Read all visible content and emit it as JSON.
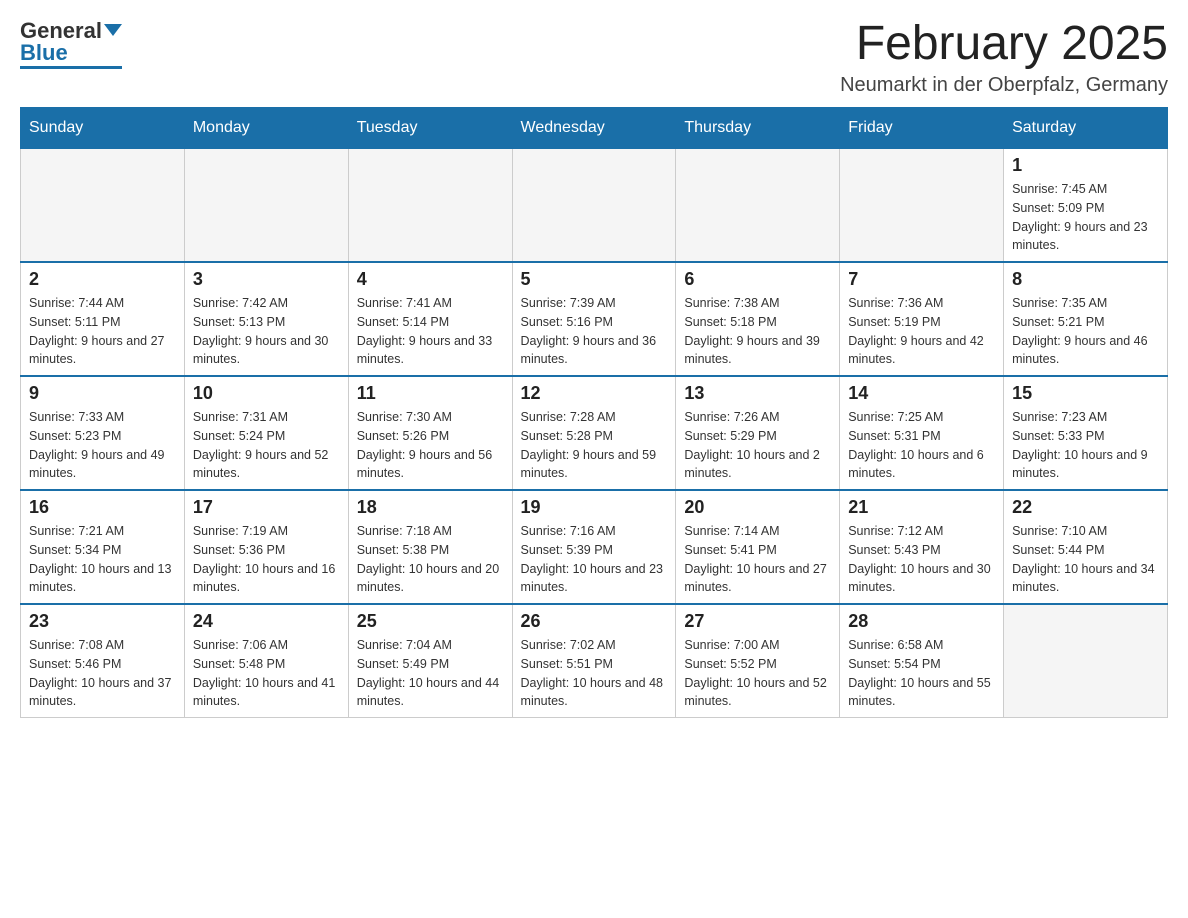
{
  "header": {
    "logo_general": "General",
    "logo_blue": "Blue",
    "month_title": "February 2025",
    "location": "Neumarkt in der Oberpfalz, Germany"
  },
  "days_of_week": [
    "Sunday",
    "Monday",
    "Tuesday",
    "Wednesday",
    "Thursday",
    "Friday",
    "Saturday"
  ],
  "weeks": [
    [
      {
        "day": "",
        "info": ""
      },
      {
        "day": "",
        "info": ""
      },
      {
        "day": "",
        "info": ""
      },
      {
        "day": "",
        "info": ""
      },
      {
        "day": "",
        "info": ""
      },
      {
        "day": "",
        "info": ""
      },
      {
        "day": "1",
        "info": "Sunrise: 7:45 AM\nSunset: 5:09 PM\nDaylight: 9 hours and 23 minutes."
      }
    ],
    [
      {
        "day": "2",
        "info": "Sunrise: 7:44 AM\nSunset: 5:11 PM\nDaylight: 9 hours and 27 minutes."
      },
      {
        "day": "3",
        "info": "Sunrise: 7:42 AM\nSunset: 5:13 PM\nDaylight: 9 hours and 30 minutes."
      },
      {
        "day": "4",
        "info": "Sunrise: 7:41 AM\nSunset: 5:14 PM\nDaylight: 9 hours and 33 minutes."
      },
      {
        "day": "5",
        "info": "Sunrise: 7:39 AM\nSunset: 5:16 PM\nDaylight: 9 hours and 36 minutes."
      },
      {
        "day": "6",
        "info": "Sunrise: 7:38 AM\nSunset: 5:18 PM\nDaylight: 9 hours and 39 minutes."
      },
      {
        "day": "7",
        "info": "Sunrise: 7:36 AM\nSunset: 5:19 PM\nDaylight: 9 hours and 42 minutes."
      },
      {
        "day": "8",
        "info": "Sunrise: 7:35 AM\nSunset: 5:21 PM\nDaylight: 9 hours and 46 minutes."
      }
    ],
    [
      {
        "day": "9",
        "info": "Sunrise: 7:33 AM\nSunset: 5:23 PM\nDaylight: 9 hours and 49 minutes."
      },
      {
        "day": "10",
        "info": "Sunrise: 7:31 AM\nSunset: 5:24 PM\nDaylight: 9 hours and 52 minutes."
      },
      {
        "day": "11",
        "info": "Sunrise: 7:30 AM\nSunset: 5:26 PM\nDaylight: 9 hours and 56 minutes."
      },
      {
        "day": "12",
        "info": "Sunrise: 7:28 AM\nSunset: 5:28 PM\nDaylight: 9 hours and 59 minutes."
      },
      {
        "day": "13",
        "info": "Sunrise: 7:26 AM\nSunset: 5:29 PM\nDaylight: 10 hours and 2 minutes."
      },
      {
        "day": "14",
        "info": "Sunrise: 7:25 AM\nSunset: 5:31 PM\nDaylight: 10 hours and 6 minutes."
      },
      {
        "day": "15",
        "info": "Sunrise: 7:23 AM\nSunset: 5:33 PM\nDaylight: 10 hours and 9 minutes."
      }
    ],
    [
      {
        "day": "16",
        "info": "Sunrise: 7:21 AM\nSunset: 5:34 PM\nDaylight: 10 hours and 13 minutes."
      },
      {
        "day": "17",
        "info": "Sunrise: 7:19 AM\nSunset: 5:36 PM\nDaylight: 10 hours and 16 minutes."
      },
      {
        "day": "18",
        "info": "Sunrise: 7:18 AM\nSunset: 5:38 PM\nDaylight: 10 hours and 20 minutes."
      },
      {
        "day": "19",
        "info": "Sunrise: 7:16 AM\nSunset: 5:39 PM\nDaylight: 10 hours and 23 minutes."
      },
      {
        "day": "20",
        "info": "Sunrise: 7:14 AM\nSunset: 5:41 PM\nDaylight: 10 hours and 27 minutes."
      },
      {
        "day": "21",
        "info": "Sunrise: 7:12 AM\nSunset: 5:43 PM\nDaylight: 10 hours and 30 minutes."
      },
      {
        "day": "22",
        "info": "Sunrise: 7:10 AM\nSunset: 5:44 PM\nDaylight: 10 hours and 34 minutes."
      }
    ],
    [
      {
        "day": "23",
        "info": "Sunrise: 7:08 AM\nSunset: 5:46 PM\nDaylight: 10 hours and 37 minutes."
      },
      {
        "day": "24",
        "info": "Sunrise: 7:06 AM\nSunset: 5:48 PM\nDaylight: 10 hours and 41 minutes."
      },
      {
        "day": "25",
        "info": "Sunrise: 7:04 AM\nSunset: 5:49 PM\nDaylight: 10 hours and 44 minutes."
      },
      {
        "day": "26",
        "info": "Sunrise: 7:02 AM\nSunset: 5:51 PM\nDaylight: 10 hours and 48 minutes."
      },
      {
        "day": "27",
        "info": "Sunrise: 7:00 AM\nSunset: 5:52 PM\nDaylight: 10 hours and 52 minutes."
      },
      {
        "day": "28",
        "info": "Sunrise: 6:58 AM\nSunset: 5:54 PM\nDaylight: 10 hours and 55 minutes."
      },
      {
        "day": "",
        "info": ""
      }
    ]
  ]
}
